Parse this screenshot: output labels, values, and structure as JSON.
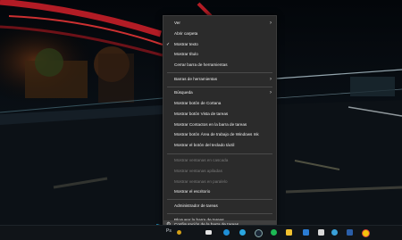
{
  "menu": {
    "items": [
      {
        "label": "Ver",
        "submenu": true
      },
      {
        "label": "Abrir carpeta"
      },
      {
        "label": "Mostrar texto",
        "checked": true
      },
      {
        "label": "Mostrar título"
      },
      {
        "label": "Cerrar barra de herramientas"
      },
      {
        "label": "Barras de herramientas",
        "submenu": true
      },
      {
        "label": "Búsqueda",
        "submenu": true
      },
      {
        "label": "Mostrar botón de Cortana"
      },
      {
        "label": "Mostrar botón Vista de tareas"
      },
      {
        "label": "Mostrar Contactos en la barra de tareas"
      },
      {
        "label": "Mostrar botón Área de trabajo de Windows Ink"
      },
      {
        "label": "Mostrar el botón del teclado táctil"
      },
      {
        "label": "Mostrar ventanas en cascada",
        "disabled": true
      },
      {
        "label": "Mostrar ventanas apiladas",
        "disabled": true
      },
      {
        "label": "Mostrar ventanas en paralelo",
        "disabled": true
      },
      {
        "label": "Mostrar el escritorio"
      },
      {
        "label": "Administrador de tareas"
      },
      {
        "label": "Bloquear la barra de tareas"
      },
      {
        "label": "Configuración de la barra de tareas",
        "icon": "gear-icon"
      }
    ]
  },
  "taskbar": {
    "text_label": "Ps",
    "icons": [
      "mail-icon",
      "edge-icon",
      "telegram-icon",
      "steam-icon",
      "spotify-icon",
      "notes-icon",
      "word-icon",
      "calendar-icon",
      "circle-app-icon",
      "code-icon",
      "chrome-icon"
    ]
  },
  "colors": {
    "menu_bg": "#2b2b2b",
    "accent_arrow": "#27a9d8"
  }
}
